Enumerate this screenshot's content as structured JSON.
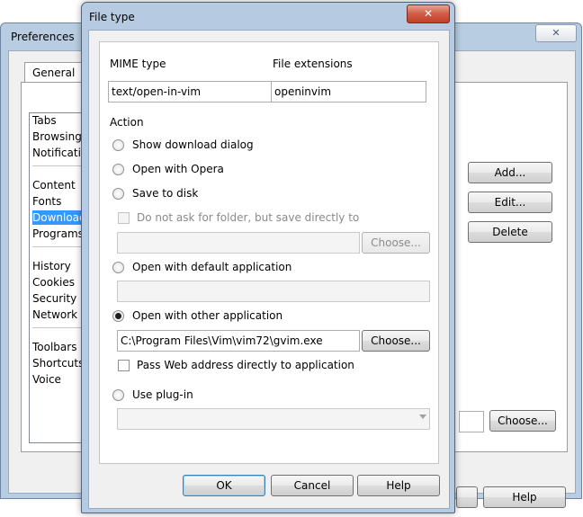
{
  "preferences": {
    "title": "Preferences",
    "close_glyph": "✕",
    "tabs": [
      "General"
    ],
    "sidebar": [
      "Tabs",
      "Browsing",
      "Notifications",
      "Content",
      "Fonts",
      "Downloads",
      "Programs",
      "History",
      "Cookies",
      "Security",
      "Network",
      "Toolbars",
      "Shortcuts",
      "Voice"
    ],
    "selected_item": "Downloads",
    "buttons": {
      "add": "Add...",
      "edit": "Edit...",
      "delete": "Delete",
      "choose": "Choose...",
      "help": "Help"
    }
  },
  "dialog": {
    "title": "File type",
    "close_glyph": "✕",
    "mime_label": "MIME type",
    "ext_label": "File extensions",
    "mime_value": "text/open-in-vim",
    "ext_value": "openinvim",
    "action_label": "Action",
    "options": {
      "show_dialog": "Show download dialog",
      "open_opera": "Open with Opera",
      "save_disk": "Save to disk",
      "no_ask": "Do not ask for folder, but save directly to",
      "open_default": "Open with default application",
      "open_other": "Open with other application",
      "pass_web": "Pass Web address directly to application",
      "use_plugin": "Use plug-in"
    },
    "save_path": "",
    "default_app": "",
    "other_app_path": "C:\\Program Files\\Vim\\vim72\\gvim.exe",
    "plugin_value": "",
    "choose_label": "Choose...",
    "ok_label": "OK",
    "cancel_label": "Cancel",
    "help_label": "Help",
    "selected_action": "open_other"
  }
}
